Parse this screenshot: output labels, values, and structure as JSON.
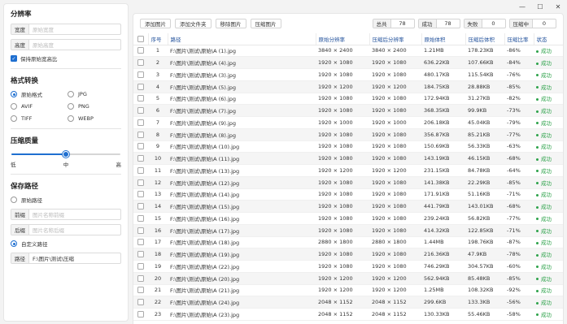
{
  "window": {
    "minimize": "—",
    "maximize": "☐",
    "close": "✕"
  },
  "resolution": {
    "title": "分辨率",
    "width_label": "宽度",
    "width_placeholder": "原始宽度",
    "height_label": "高度",
    "height_placeholder": "原始高度",
    "keep_ratio_label": "保持原始宽高比",
    "keep_ratio_checked": true
  },
  "format": {
    "title": "格式转换",
    "options": [
      {
        "label": "原始格式",
        "selected": true
      },
      {
        "label": "JPG",
        "selected": false
      },
      {
        "label": "AVIF",
        "selected": false
      },
      {
        "label": "PNG",
        "selected": false
      },
      {
        "label": "TIFF",
        "selected": false
      },
      {
        "label": "WEBP",
        "selected": false
      }
    ]
  },
  "quality": {
    "title": "压缩质量",
    "level": 0.5,
    "ticks": [
      "低",
      "中",
      "高"
    ]
  },
  "save": {
    "title": "保存路径",
    "original_label": "原始路径",
    "original_selected": false,
    "prefix_label": "前缀",
    "prefix_placeholder": "图片名称前缀",
    "suffix_label": "后缀",
    "suffix_placeholder": "图片名称后缀",
    "custom_label": "自定义路径",
    "custom_selected": true,
    "path_label": "路径",
    "path_value": "F:\\图片\\测试\\压缩"
  },
  "toolbar": {
    "add_image": "添加图片",
    "add_folder": "添加文件夹",
    "remove_image": "移除图片",
    "compress": "压缩图片"
  },
  "stats": [
    {
      "label": "总共",
      "value": "78"
    },
    {
      "label": "成功",
      "value": "78"
    },
    {
      "label": "失败",
      "value": "0"
    },
    {
      "label": "压缩中",
      "value": "0"
    }
  ],
  "table": {
    "headers": [
      "序号",
      "路径",
      "原始分辨率",
      "压缩后分辨率",
      "原始体积",
      "压缩后体积",
      "压缩比率",
      "状态"
    ],
    "rows": [
      [
        "1",
        "F:\\图片\\测试\\原始\\A (1).jpg",
        "3840 × 2400",
        "3840 × 2400",
        "1.21MB",
        "178.23KB",
        "-86%",
        "成功"
      ],
      [
        "2",
        "F:\\图片\\测试\\原始\\A (4).jpg",
        "1920 × 1080",
        "1920 × 1080",
        "636.22KB",
        "107.66KB",
        "-84%",
        "成功"
      ],
      [
        "3",
        "F:\\图片\\测试\\原始\\A (3).jpg",
        "1920 × 1080",
        "1920 × 1080",
        "480.17KB",
        "115.54KB",
        "-76%",
        "成功"
      ],
      [
        "4",
        "F:\\图片\\测试\\原始\\A (5).jpg",
        "1920 × 1200",
        "1920 × 1200",
        "184.75KB",
        "28.88KB",
        "-85%",
        "成功"
      ],
      [
        "5",
        "F:\\图片\\测试\\原始\\A (6).jpg",
        "1920 × 1080",
        "1920 × 1080",
        "172.94KB",
        "31.27KB",
        "-82%",
        "成功"
      ],
      [
        "6",
        "F:\\图片\\测试\\原始\\A (7).jpg",
        "1920 × 1080",
        "1920 × 1080",
        "368.35KB",
        "99.9KB",
        "-73%",
        "成功"
      ],
      [
        "7",
        "F:\\图片\\测试\\原始\\A (9).jpg",
        "1920 × 1000",
        "1920 × 1000",
        "206.18KB",
        "45.04KB",
        "-79%",
        "成功"
      ],
      [
        "8",
        "F:\\图片\\测试\\原始\\A (8).jpg",
        "1920 × 1080",
        "1920 × 1080",
        "356.87KB",
        "85.21KB",
        "-77%",
        "成功"
      ],
      [
        "9",
        "F:\\图片\\测试\\原始\\A (10).jpg",
        "1920 × 1080",
        "1920 × 1080",
        "150.69KB",
        "56.33KB",
        "-63%",
        "成功"
      ],
      [
        "10",
        "F:\\图片\\测试\\原始\\A (11).jpg",
        "1920 × 1080",
        "1920 × 1080",
        "143.19KB",
        "46.15KB",
        "-68%",
        "成功"
      ],
      [
        "11",
        "F:\\图片\\测试\\原始\\A (13).jpg",
        "1920 × 1200",
        "1920 × 1200",
        "231.15KB",
        "84.78KB",
        "-64%",
        "成功"
      ],
      [
        "12",
        "F:\\图片\\测试\\原始\\A (12).jpg",
        "1920 × 1080",
        "1920 × 1080",
        "141.38KB",
        "22.29KB",
        "-85%",
        "成功"
      ],
      [
        "13",
        "F:\\图片\\测试\\原始\\A (14).jpg",
        "1920 × 1080",
        "1920 × 1080",
        "171.91KB",
        "51.16KB",
        "-71%",
        "成功"
      ],
      [
        "14",
        "F:\\图片\\测试\\原始\\A (15).jpg",
        "1920 × 1080",
        "1920 × 1080",
        "441.79KB",
        "143.01KB",
        "-68%",
        "成功"
      ],
      [
        "15",
        "F:\\图片\\测试\\原始\\A (16).jpg",
        "1920 × 1080",
        "1920 × 1080",
        "239.24KB",
        "56.82KB",
        "-77%",
        "成功"
      ],
      [
        "16",
        "F:\\图片\\测试\\原始\\A (17).jpg",
        "1920 × 1080",
        "1920 × 1080",
        "414.32KB",
        "122.85KB",
        "-71%",
        "成功"
      ],
      [
        "17",
        "F:\\图片\\测试\\原始\\A (18).jpg",
        "2880 × 1800",
        "2880 × 1800",
        "1.44MB",
        "198.76KB",
        "-87%",
        "成功"
      ],
      [
        "18",
        "F:\\图片\\测试\\原始\\A (19).jpg",
        "1920 × 1080",
        "1920 × 1080",
        "216.36KB",
        "47.9KB",
        "-78%",
        "成功"
      ],
      [
        "19",
        "F:\\图片\\测试\\原始\\A (22).jpg",
        "1920 × 1080",
        "1920 × 1080",
        "746.29KB",
        "304.57KB",
        "-60%",
        "成功"
      ],
      [
        "20",
        "F:\\图片\\测试\\原始\\A (20).jpg",
        "1920 × 1200",
        "1920 × 1200",
        "562.94KB",
        "85.48KB",
        "-85%",
        "成功"
      ],
      [
        "21",
        "F:\\图片\\测试\\原始\\A (21).jpg",
        "1920 × 1200",
        "1920 × 1200",
        "1.25MB",
        "108.32KB",
        "-92%",
        "成功"
      ],
      [
        "22",
        "F:\\图片\\测试\\原始\\A (24).jpg",
        "2048 × 1152",
        "2048 × 1152",
        "299.6KB",
        "133.3KB",
        "-56%",
        "成功"
      ],
      [
        "23",
        "F:\\图片\\测试\\原始\\A (23).jpg",
        "2048 × 1152",
        "2048 × 1152",
        "130.33KB",
        "55.46KB",
        "-58%",
        "成功"
      ]
    ]
  },
  "colors": {
    "accent": "#1f6fd0",
    "success": "#2da24a",
    "header_text": "#1f4f9a"
  }
}
